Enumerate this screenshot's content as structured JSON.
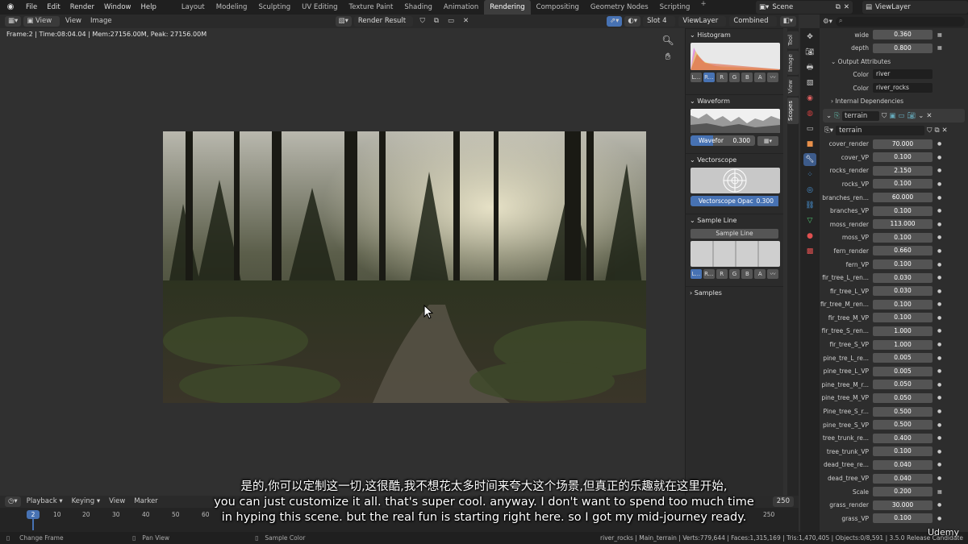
{
  "topbar": {
    "menus": [
      "File",
      "Edit",
      "Render",
      "Window",
      "Help"
    ],
    "workspaces": [
      "Layout",
      "Modeling",
      "Sculpting",
      "UV Editing",
      "Texture Paint",
      "Shading",
      "Animation",
      "Rendering",
      "Compositing",
      "Geometry Nodes",
      "Scripting"
    ],
    "active_workspace": "Rendering",
    "scene": "Scene",
    "view_layer": "ViewLayer"
  },
  "image_header": {
    "view_menu": "View",
    "menu_view": "View",
    "menu_image": "Image",
    "image_name": "Render Result",
    "slot": "Slot 4",
    "layer": "ViewLayer",
    "pass": "Combined"
  },
  "viewport": {
    "stats": "Frame:2 | Time:08:04.04 | Mem:27156.00M, Peak: 27156.00M"
  },
  "scopes": {
    "histogram": {
      "title": "Histogram",
      "channels": [
        "L...",
        "R...",
        "R",
        "G",
        "B",
        "A"
      ],
      "selected": 1
    },
    "waveform": {
      "title": "Waveform",
      "slider_label": "Wavefor",
      "slider_value": "0.300"
    },
    "vectorscope": {
      "title": "Vectorscope",
      "slider_label": "Vectorscope Opac",
      "slider_value": "0.300"
    },
    "sample_line": {
      "title": "Sample Line",
      "button": "Sample Line",
      "channels": [
        "L...",
        "R...",
        "R",
        "G",
        "B",
        "A"
      ],
      "selected": 0
    },
    "samples": {
      "title": "Samples"
    }
  },
  "vertical_tabs": [
    "Tool",
    "Image",
    "View",
    "Scopes"
  ],
  "properties": {
    "top_fields": [
      {
        "label": "wide",
        "value": "0.360"
      },
      {
        "label": "depth",
        "value": "0.800"
      }
    ],
    "output_attributes": {
      "title": "Output Attributes",
      "items": [
        {
          "label": "Color",
          "value": "river"
        },
        {
          "label": "Color",
          "value": "river_rocks"
        }
      ]
    },
    "internal_dependencies": "Internal Dependencies",
    "modifier_name": "terrain",
    "object_name": "terrain",
    "params": [
      {
        "label": "cover_render",
        "value": "70.000"
      },
      {
        "label": "cover_VP",
        "value": "0.100"
      },
      {
        "label": "rocks_render",
        "value": "2.150"
      },
      {
        "label": "rocks_VP",
        "value": "0.100"
      },
      {
        "label": "branches_ren...",
        "value": "60.000"
      },
      {
        "label": "branches_VP",
        "value": "0.100"
      },
      {
        "label": "moss_render",
        "value": "113.000"
      },
      {
        "label": "moss_VP",
        "value": "0.100"
      },
      {
        "label": "fern_render",
        "value": "0.660"
      },
      {
        "label": "fern_VP",
        "value": "0.100"
      },
      {
        "label": "fir_tree_L_ren...",
        "value": "0.030"
      },
      {
        "label": "fir_tree_L_VP",
        "value": "0.030"
      },
      {
        "label": "fir_tree_M_ren...",
        "value": "0.100"
      },
      {
        "label": "fir_tree_M_VP",
        "value": "0.100"
      },
      {
        "label": "fir_tree_S_ren...",
        "value": "1.000"
      },
      {
        "label": "fir_tree_S_VP",
        "value": "1.000"
      },
      {
        "label": "pine_tre_L_re...",
        "value": "0.005"
      },
      {
        "label": "pine_tree_L_VP",
        "value": "0.005"
      },
      {
        "label": "pine_tree_M_r...",
        "value": "0.050"
      },
      {
        "label": "pine_tree_M_VP",
        "value": "0.050"
      },
      {
        "label": "Pine_tree_S_r...",
        "value": "0.500"
      },
      {
        "label": "pine_tree_S_VP",
        "value": "0.500"
      },
      {
        "label": "tree_trunk_re...",
        "value": "0.400"
      },
      {
        "label": "tree_trunk_VP",
        "value": "0.100"
      },
      {
        "label": "dead_tree_re...",
        "value": "0.040"
      },
      {
        "label": "dead_tree_VP",
        "value": "0.040"
      },
      {
        "label": "Scale",
        "value": "0.200"
      },
      {
        "label": "grass_render",
        "value": "30.000"
      },
      {
        "label": "grass_VP",
        "value": "0.100"
      }
    ]
  },
  "timeline": {
    "menus": [
      "Playback",
      "Keying",
      "View",
      "Marker"
    ],
    "current_frame": "2",
    "end_frame": "250",
    "end_field": "250",
    "ticks": [
      "10",
      "20",
      "30",
      "40",
      "50",
      "60"
    ]
  },
  "statusbar": {
    "change_frame": "Change Frame",
    "pan_view": "Pan View",
    "sample_color": "Sample Color",
    "stats": "river_rocks | Main_terrain | Verts:779,644 | Faces:1,315,169 | Tris:1,470,405 | Objects:0/8,591 | 3.5.0 Release Candidate"
  },
  "subtitles": {
    "zh": "是的,你可以定制这一切,这很酷,我不想花太多时间来夸大这个场景,但真正的乐趣就在这里开始,",
    "en1": "you can just customize it all. that's super cool. anyway. I don't want to spend too much time",
    "en2": "in hyping this scene. but the real fun is starting right here. so I got my mid-journey ready."
  },
  "watermark": "Udemy"
}
